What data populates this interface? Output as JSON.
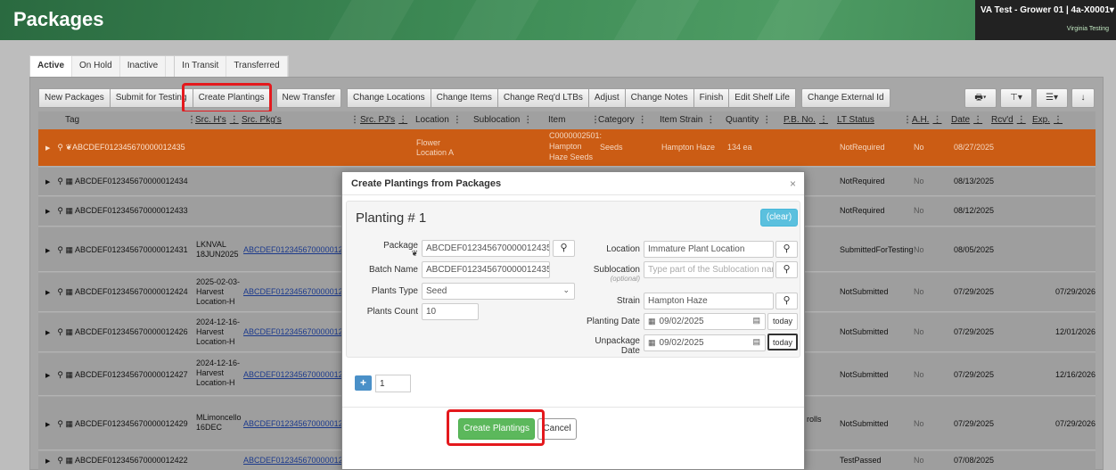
{
  "header": {
    "title": "Packages",
    "account_name": "VA Test - Grower 01 | 4a-X0001",
    "account_sub": "Virginia Testing",
    "brand_color": "#3f8d57"
  },
  "tabs": [
    {
      "label": "Active",
      "active": true
    },
    {
      "label": "On Hold"
    },
    {
      "label": "Inactive"
    },
    {
      "label": "In Transit"
    },
    {
      "label": "Transferred"
    }
  ],
  "toolbar": {
    "new_packages": "New Packages",
    "submit_for_testing": "Submit for Testing",
    "create_plantings": "Create Plantings",
    "new_transfer": "New Transfer",
    "change_locations": "Change Locations",
    "change_items": "Change Items",
    "change_reqd_ltbs": "Change Req'd LTBs",
    "adjust": "Adjust",
    "change_notes": "Change Notes",
    "finish": "Finish",
    "edit_shelf_life": "Edit Shelf Life",
    "change_external_id": "Change External Id",
    "print_icon": "print-icon",
    "filter_icon": "filter-icon",
    "columns_icon": "columns-icon",
    "download_icon": "download-icon"
  },
  "columns": {
    "tag": "Tag",
    "src_hs": "Src. H's",
    "src_pkgs": "Src. Pkg's",
    "src_pjs": "Src. PJ's",
    "location": "Location",
    "sublocation": "Sublocation",
    "item": "Item",
    "category": "Category",
    "item_strain": "Item Strain",
    "quantity": "Quantity",
    "pb_no": "P.B. No.",
    "lt_status": "LT Status",
    "ah": "A.H.",
    "date": "Date",
    "rcvd": "Rcv'd",
    "exp": "Exp."
  },
  "rows": [
    {
      "tag": "ABCDEF012345670000012435",
      "location": "Flower",
      "location2": "Location A",
      "item": "C0000002501:",
      "item2": "Hampton",
      "item3": "Haze Seeds",
      "category": "Seeds",
      "strain": "Hampton Haze",
      "qty": "134 ea",
      "lt": "NotRequired",
      "ah": "No",
      "date": "08/27/2025"
    },
    {
      "tag": "ABCDEF012345670000012434",
      "lt": "NotRequired",
      "ah": "No",
      "date": "08/13/2025"
    },
    {
      "tag": "ABCDEF012345670000012433",
      "lt": "NotRequired",
      "ah": "No",
      "date": "08/12/2025"
    },
    {
      "tag": "ABCDEF012345670000012431",
      "src_h1": "LKNVAL",
      "src_h2": "18JUN2025",
      "src_pkg": "ABCDEF0123456700000124",
      "lt": "SubmittedForTesting",
      "ah": "No",
      "date": "08/05/2025"
    },
    {
      "tag": "ABCDEF012345670000012424",
      "src_h1": "2025-02-03-",
      "src_h2": "Harvest",
      "src_h3": "Location-H",
      "src_pkg": "ABCDEF0123456700000124",
      "lt": "NotSubmitted",
      "ah": "No",
      "date": "07/29/2025",
      "exp": "07/29/2026"
    },
    {
      "tag": "ABCDEF012345670000012426",
      "src_h1": "2024-12-16-",
      "src_h2": "Harvest",
      "src_h3": "Location-H",
      "src_pkg": "ABCDEF0123456700000124",
      "lt": "NotSubmitted",
      "ah": "No",
      "date": "07/29/2025",
      "exp": "12/01/2026"
    },
    {
      "tag": "ABCDEF012345670000012427",
      "src_h1": "2024-12-16-",
      "src_h2": "Harvest",
      "src_h3": "Location-H",
      "src_pkg": "ABCDEF0123456700000124",
      "lt": "NotSubmitted",
      "ah": "No",
      "date": "07/29/2025",
      "exp": "12/16/2026"
    },
    {
      "tag": "ABCDEF012345670000012429",
      "src_h1": "MLimoncello",
      "src_h2": "16DEC",
      "src_pkg": "ABCDEF0123456700000124",
      "qty_tail": "rolls",
      "lt": "NotSubmitted",
      "ah": "No",
      "date": "07/29/2025",
      "exp": "07/29/2026"
    },
    {
      "tag": "ABCDEF012345670000012422",
      "src_pkg": "ABCDEF0123456700000124",
      "lt": "TestPassed",
      "ah": "No",
      "date": "07/08/2025"
    }
  ],
  "modal": {
    "title": "Create Plantings from Packages",
    "close": "×",
    "planting_heading": "Planting # 1",
    "clear_label": "(clear)",
    "package_label": "Package",
    "package_value": "ABCDEF012345670000012435",
    "batch_name_label": "Batch Name",
    "batch_name_value": "ABCDEF012345670000012435",
    "plants_type_label": "Plants Type",
    "plants_type_value": "Seed",
    "plants_count_label": "Plants Count",
    "plants_count_value": "10",
    "location_label": "Location",
    "location_value": "Immature Plant Location",
    "sublocation_label": "Sublocation",
    "sublocation_hint": "(optional)",
    "sublocation_placeholder": "Type part of the Sublocation nam",
    "strain_label": "Strain",
    "strain_value": "Hampton Haze",
    "planting_date_label": "Planting Date",
    "planting_date_value": "09/02/2025",
    "unpackage_label": "Unpackage",
    "unpackage_label2": "Date",
    "unpackage_value": "09/02/2025",
    "today_label": "today",
    "add_count_value": "1",
    "create_button": "Create Plantings",
    "cancel_button": "Cancel",
    "highlight_color": "#e4191d",
    "create_color": "#5cb85c",
    "clear_color": "#5bc0de"
  }
}
